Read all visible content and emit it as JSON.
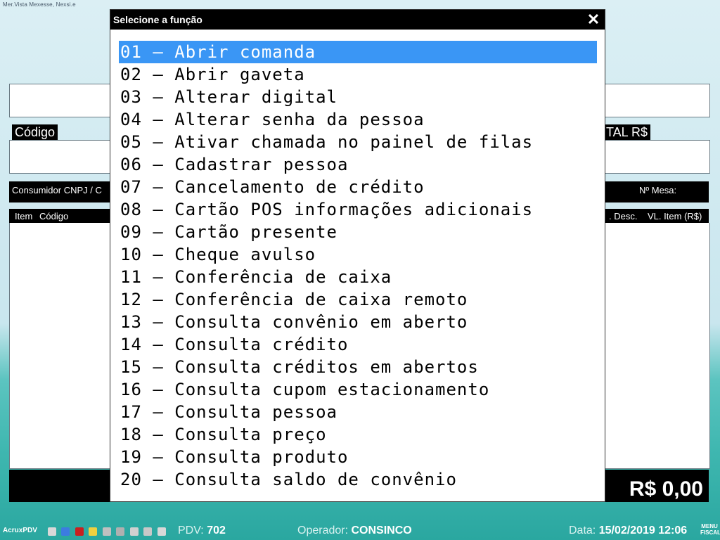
{
  "top_caption": "Mer.Vista Mexesse, Nexsi.e",
  "background": {
    "codigo_label": "Código",
    "total_label": "TAL R$",
    "consumidor_label": "Consumidor CNPJ / C",
    "mesa_label": "Nº Mesa:",
    "col_item": "Item",
    "col_codigo": "Código",
    "col_desc": ". Desc.",
    "col_vl_item": "VL. Item (R$)",
    "total_value": "R$ 0,00"
  },
  "dialog": {
    "title": "Selecione a função",
    "close_icon": "close-x-icon",
    "selected_index": 0,
    "selection_color": "#3a96f5",
    "items": [
      "01 – Abrir comanda",
      "02 – Abrir gaveta",
      "03 – Alterar digital",
      "04 – Alterar senha da pessoa",
      "05 – Ativar chamada no painel de filas",
      "06 – Cadastrar pessoa",
      "07 – Cancelamento de crédito",
      "08 – Cartão POS informações adicionais",
      "09 – Cartão presente",
      "10 – Cheque avulso",
      "11 – Conferência de caixa",
      "12 – Conferência de caixa remoto",
      "13 – Consulta convênio em aberto",
      "14 – Consulta crédito",
      "15 – Consulta créditos em abertos",
      "16 – Consulta cupom estacionamento",
      "17 – Consulta pessoa",
      "18 – Consulta preço",
      "19 – Consulta produto",
      "20 – Consulta saldo de convênio"
    ]
  },
  "status_bar": {
    "app_name": "AcruxPDV",
    "pdv_label": "PDV:",
    "pdv_value": "702",
    "operador_label": "Operador:",
    "operador_value": "CONSINCO",
    "data_label": "Data:",
    "data_value": "15/02/2019 12:06",
    "menu_label": "MENU\nFISCAL"
  }
}
